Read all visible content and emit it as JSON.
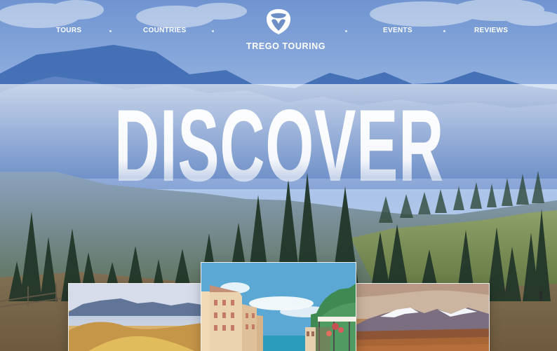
{
  "nav": {
    "left_items": [
      {
        "label": "TOURS"
      },
      {
        "label": "COUNTRIES"
      }
    ],
    "brand": {
      "name": "TREGO TOURING"
    },
    "right_items": [
      {
        "label": "EVENTS"
      },
      {
        "label": "REVIEWS"
      }
    ]
  },
  "hero": {
    "headline": "DISCOVER"
  },
  "gallery": {
    "cards": [
      {
        "name": "mountain-fog-card"
      },
      {
        "name": "coastal-town-card"
      },
      {
        "name": "desert-mountain-card"
      }
    ]
  }
}
